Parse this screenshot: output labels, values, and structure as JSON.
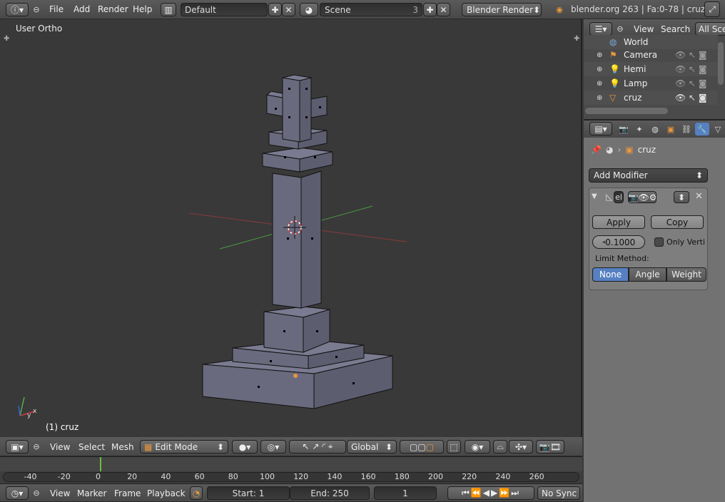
{
  "top_bar": {
    "menus": [
      "File",
      "Add",
      "Render",
      "Help"
    ],
    "layout": "Default",
    "scene": "Scene",
    "scene_users": "3",
    "engine": "Blender Render",
    "stats": "blender.org 263 | Fa:0-78 | cruz"
  },
  "viewport": {
    "view_label": "User Ortho",
    "object_label": "(1) cruz"
  },
  "view_header": {
    "menus": [
      "View",
      "Select",
      "Mesh"
    ],
    "mode": "Edit Mode",
    "orientation": "Global"
  },
  "timeline": {
    "ticks": [
      "-40",
      "-20",
      "0",
      "20",
      "40",
      "60",
      "80",
      "100",
      "120",
      "140",
      "160",
      "180",
      "200",
      "220",
      "240",
      "260"
    ],
    "menus": [
      "View",
      "Marker",
      "Frame",
      "Playback"
    ],
    "start": "Start: 1",
    "end": "End: 250",
    "current": "1",
    "sync": "No Sync"
  },
  "outliner": {
    "menus": [
      "View",
      "Search"
    ],
    "filter": "All Scen",
    "items": [
      {
        "label": "World",
        "icon": "world-icon"
      },
      {
        "label": "Camera",
        "icon": "camera-icon"
      },
      {
        "label": "Hemi",
        "icon": "lamp-icon"
      },
      {
        "label": "Lamp",
        "icon": "lamp-icon"
      },
      {
        "label": "cruz",
        "icon": "mesh-icon"
      }
    ]
  },
  "properties": {
    "object_name": "cruz",
    "add_modifier": "Add Modifier",
    "modifier_name": "el",
    "apply": "Apply",
    "copy": "Copy",
    "merge_distance": "0.1000",
    "only_verts": "Only Verti",
    "limit_method_label": "Limit Method:",
    "limit_methods": [
      "None",
      "Angle",
      "Weight"
    ],
    "active_limit": "None"
  },
  "colors": {
    "accent": "#5680c2",
    "x_axis": "#b04040",
    "y_axis": "#4a9a40",
    "mesh": "#6e6e84",
    "frame_marker": "#6dbd3c"
  }
}
